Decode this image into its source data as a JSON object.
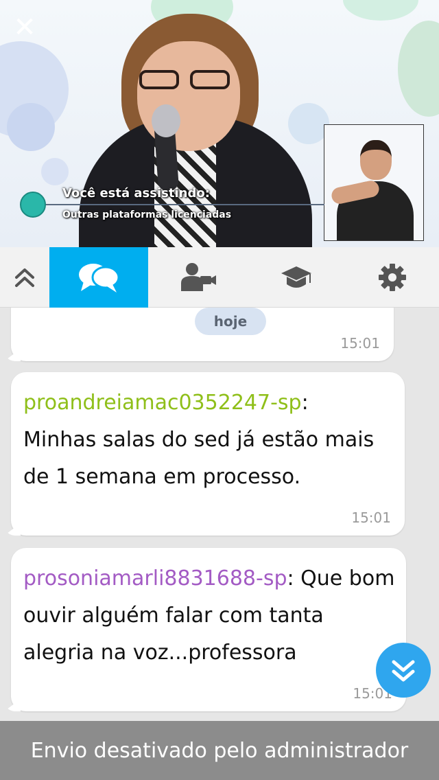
{
  "video": {
    "caption_title": "Você está assistindo:",
    "caption_subtitle": "Outras plataformas licenciadas"
  },
  "tabs": [
    {
      "icon": "chevron-double-up-icon",
      "active": false
    },
    {
      "icon": "chat-bubbles-icon",
      "active": true
    },
    {
      "icon": "user-video-icon",
      "active": false
    },
    {
      "icon": "graduation-cap-icon",
      "active": false
    },
    {
      "icon": "gear-icon",
      "active": false
    }
  ],
  "colors": {
    "accent": "#00aeef",
    "author_green": "#8fbf1a",
    "author_purple": "#a35bc4",
    "footer_bg": "#8c8c8c"
  },
  "chat": {
    "date_pill": "hoje",
    "date_time": "15:01",
    "messages": [
      {
        "author": "proandreiamac0352247-sp",
        "separator": ":",
        "text": "Minhas salas do sed já estão mais de 1 semana em processo.",
        "time": "15:01"
      },
      {
        "author": "prosoniamarli8831688-sp",
        "separator": ":",
        "text": "Que bom ouvir alguém falar com tanta alegria na voz...professora",
        "time": "15:01"
      }
    ]
  },
  "footer": {
    "status": "Envio desativado pelo administrador"
  }
}
